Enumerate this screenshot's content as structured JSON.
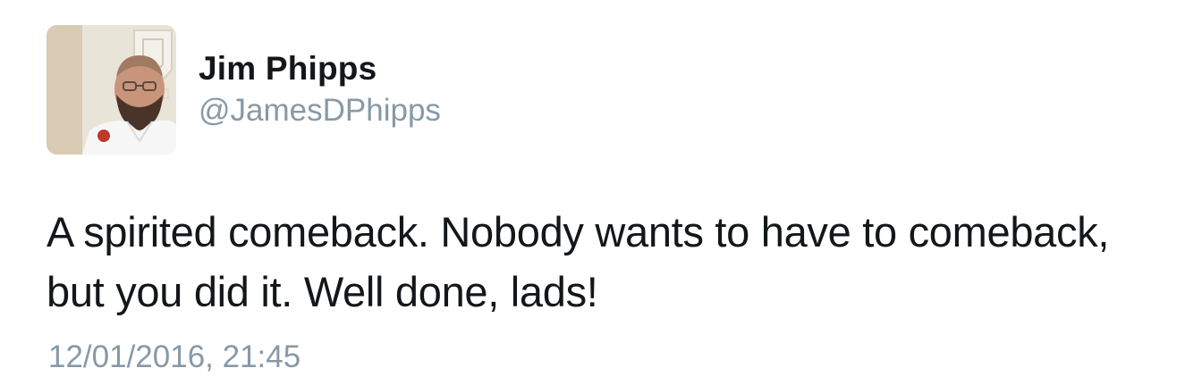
{
  "tweet": {
    "author": {
      "display_name": "Jim Phipps",
      "handle": "@JamesDPhipps",
      "avatar_icon": "profile-photo"
    },
    "text_lines": [
      "A spirited comeback. Nobody wants to have to comeback,",
      "but you did it. Well done, lads!"
    ],
    "timestamp": "12/01/2016, 21:45"
  },
  "colors": {
    "text_primary": "#14171a",
    "text_secondary": "#8899a6",
    "background": "#ffffff"
  }
}
